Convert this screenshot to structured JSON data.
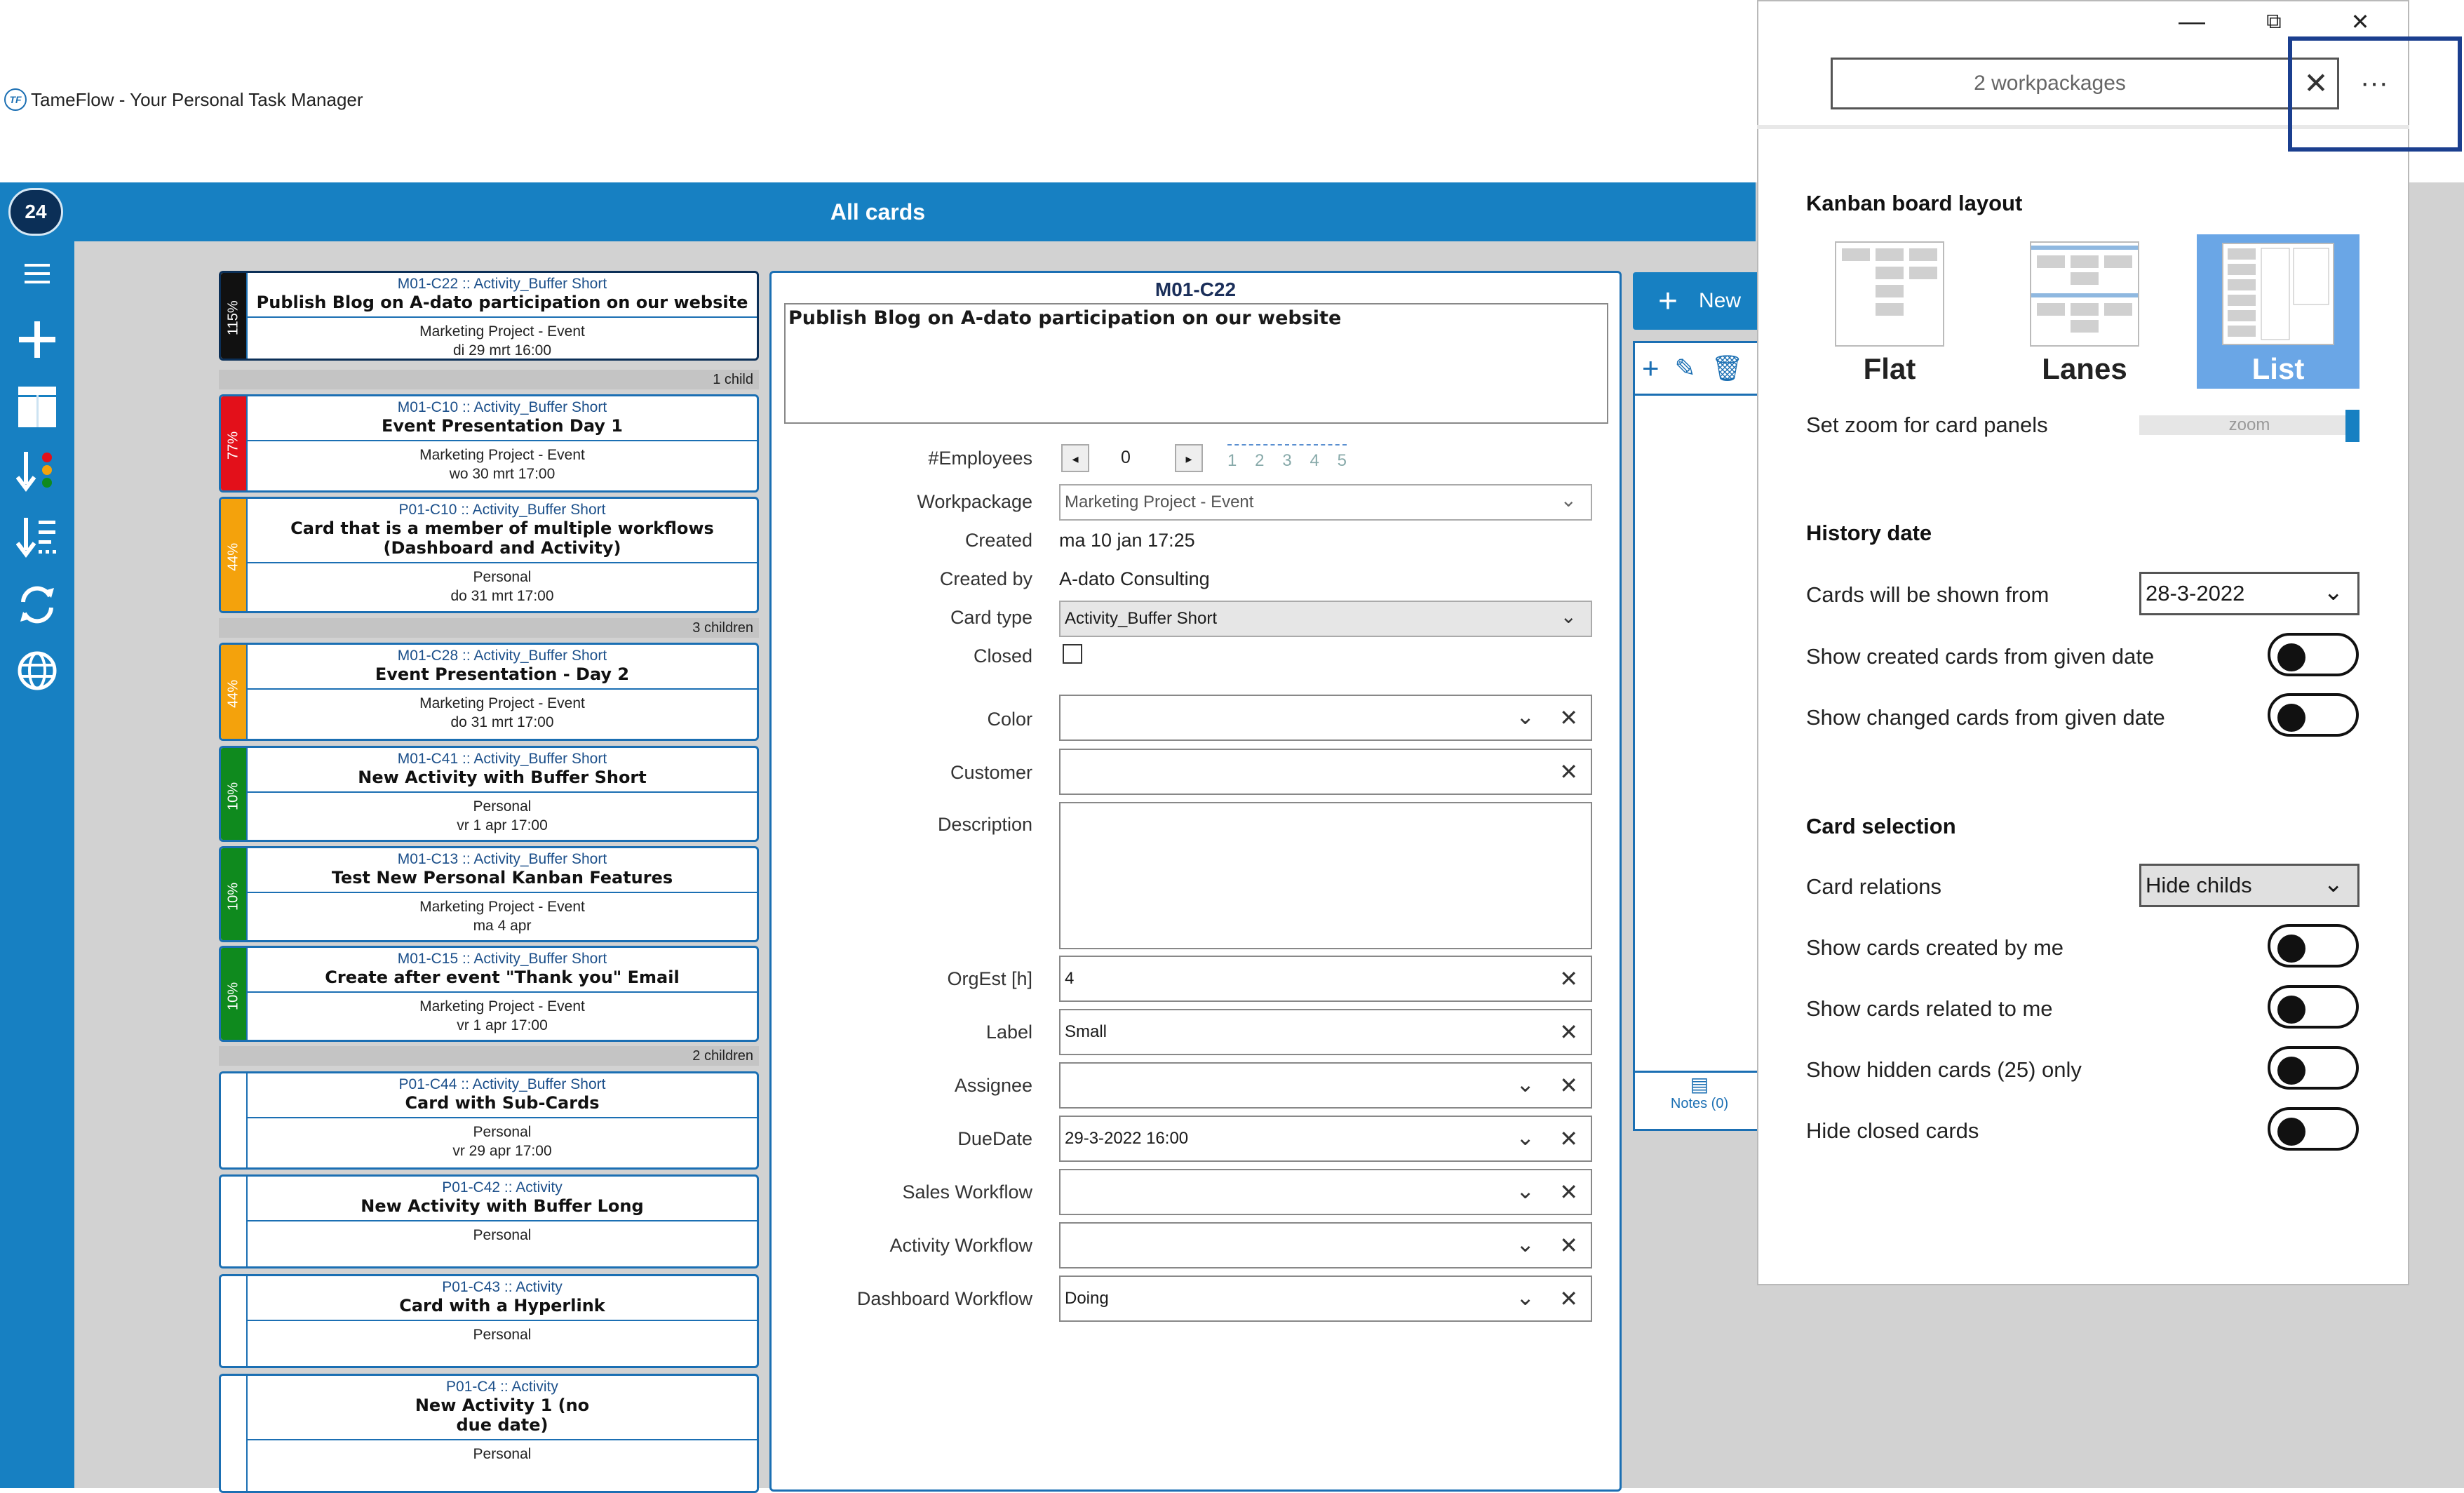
{
  "window": {
    "title": "TameFlow - Your Personal Task Manager",
    "minimize": "—",
    "restore": "⧉",
    "close": "✕"
  },
  "header": {
    "title": "All cards",
    "count_badge": "24"
  },
  "sidebar": {
    "icons": [
      "menu-icon",
      "add-icon",
      "board-icon",
      "sort-priority-icon",
      "sort-list-icon",
      "refresh-icon",
      "globe-icon"
    ]
  },
  "cards": [
    {
      "id": "M01-C22 :: Activity_Buffer Short",
      "title": "Publish Blog on A-dato participation on our website",
      "project": "Marketing Project  - Event",
      "due": "di 29 mrt 16:00",
      "pct": "115%",
      "color": "#111111"
    },
    {
      "id": "M01-C10 :: Activity_Buffer Short",
      "title": "Event Presentation Day 1",
      "project": "Marketing Project  - Event",
      "due": "wo 30 mrt 17:00",
      "pct": "77%",
      "color": "#e3101a"
    },
    {
      "id": "P01-C10 :: Activity_Buffer Short",
      "title": "Card that is a member of multiple workflows (Dashboard and Activity)",
      "project": "Personal",
      "due": "do 31 mrt 17:00",
      "pct": "44%",
      "color": "#f4a20c"
    },
    {
      "id": "M01-C28 :: Activity_Buffer Short",
      "title": "Event  Presentation - Day 2",
      "project": "Marketing Project  - Event",
      "due": "do 31 mrt 17:00",
      "pct": "44%",
      "color": "#f4a20c"
    },
    {
      "id": "M01-C41 :: Activity_Buffer Short",
      "title": "New Activity with Buffer Short",
      "project": "Personal",
      "due": "vr 1 apr 17:00",
      "pct": "10%",
      "color": "#0f8a1e"
    },
    {
      "id": "M01-C13 :: Activity_Buffer Short",
      "title": "Test New Personal Kanban Features",
      "project": "Marketing Project  - Event",
      "due": "ma 4 apr",
      "pct": "10%",
      "color": "#0f8a1e"
    },
    {
      "id": "M01-C15 :: Activity_Buffer Short",
      "title": "Create after event \"Thank you\" Email",
      "project": "Marketing Project  - Event",
      "due": "vr 1 apr 17:00",
      "pct": "10%",
      "color": "#0f8a1e"
    },
    {
      "id": "P01-C44 :: Activity_Buffer Short",
      "title": "Card with Sub-Cards",
      "project": "Personal",
      "due": "vr 29 apr 17:00",
      "pct": "",
      "color": "#ffffff"
    },
    {
      "id": "P01-C42 :: Activity",
      "title": "New Activity with Buffer Long",
      "project": "Personal",
      "due": "",
      "pct": "",
      "color": "#ffffff"
    },
    {
      "id": "P01-C43 :: Activity",
      "title": "Card with a Hyperlink",
      "project": "Personal",
      "due": "",
      "pct": "",
      "color": "#ffffff"
    },
    {
      "id": "P01-C4 :: Activity",
      "title": "New Activity 1 (no due date)",
      "project": "Personal",
      "due": "",
      "pct": "",
      "color": "#ffffff"
    }
  ],
  "child_bars": [
    "1 child",
    "3 children",
    "2 children"
  ],
  "detail": {
    "code": "M01-C22",
    "title_text": "Publish Blog on A-dato participation on our website",
    "employees_label": "#Employees",
    "employees_value": "0",
    "employees_scale": [
      "1",
      "2",
      "3",
      "4",
      "5"
    ],
    "workpackage_label": "Workpackage",
    "workpackage_value": "Marketing Project  - Event",
    "created_label": "Created",
    "created_value": "ma 10 jan 17:25",
    "createdby_label": "Created by",
    "createdby_value": "A-dato Consulting",
    "cardtype_label": "Card type",
    "cardtype_value": "Activity_Buffer Short",
    "closed_label": "Closed",
    "color_label": "Color",
    "customer_label": "Customer",
    "description_label": "Description",
    "orgest_label": "OrgEst [h]",
    "orgest_value": "4",
    "label_label": "Label",
    "label_value": "Small",
    "assignee_label": "Assignee",
    "duedate_label": "DueDate",
    "duedate_value": "29-3-2022 16:00",
    "sales_label": "Sales Workflow",
    "activity_label": "Activity Workflow",
    "dashboard_label": "Dashboard Workflow",
    "dashboard_value": "Doing"
  },
  "side_panel": {
    "new_label": "New",
    "notes_label": "Notes (0)"
  },
  "flyout": {
    "search_value": "2 workpackages",
    "more": "···",
    "layout_heading": "Kanban board layout",
    "layout_options": [
      "Flat",
      "Lanes",
      "List"
    ],
    "selected_layout": "List",
    "zoom_label": "Set zoom for card panels",
    "zoom_text": "zoom",
    "zoom_level": 1.0,
    "history_heading": "History date",
    "shown_from_label": "Cards will be shown from",
    "shown_from_value": "28-3-2022",
    "show_created_label": "Show created cards from given date",
    "show_changed_label": "Show changed cards from given date",
    "selection_heading": "Card selection",
    "relations_label": "Card relations",
    "relations_value": "Hide childs",
    "by_me_label": "Show cards created by me",
    "related_label": "Show cards related to me",
    "hidden_label": "Show hidden cards (25) only",
    "hide_closed_label": "Hide closed cards",
    "highlight_color": "#1b3f8f",
    "accent": "#1780c2"
  }
}
